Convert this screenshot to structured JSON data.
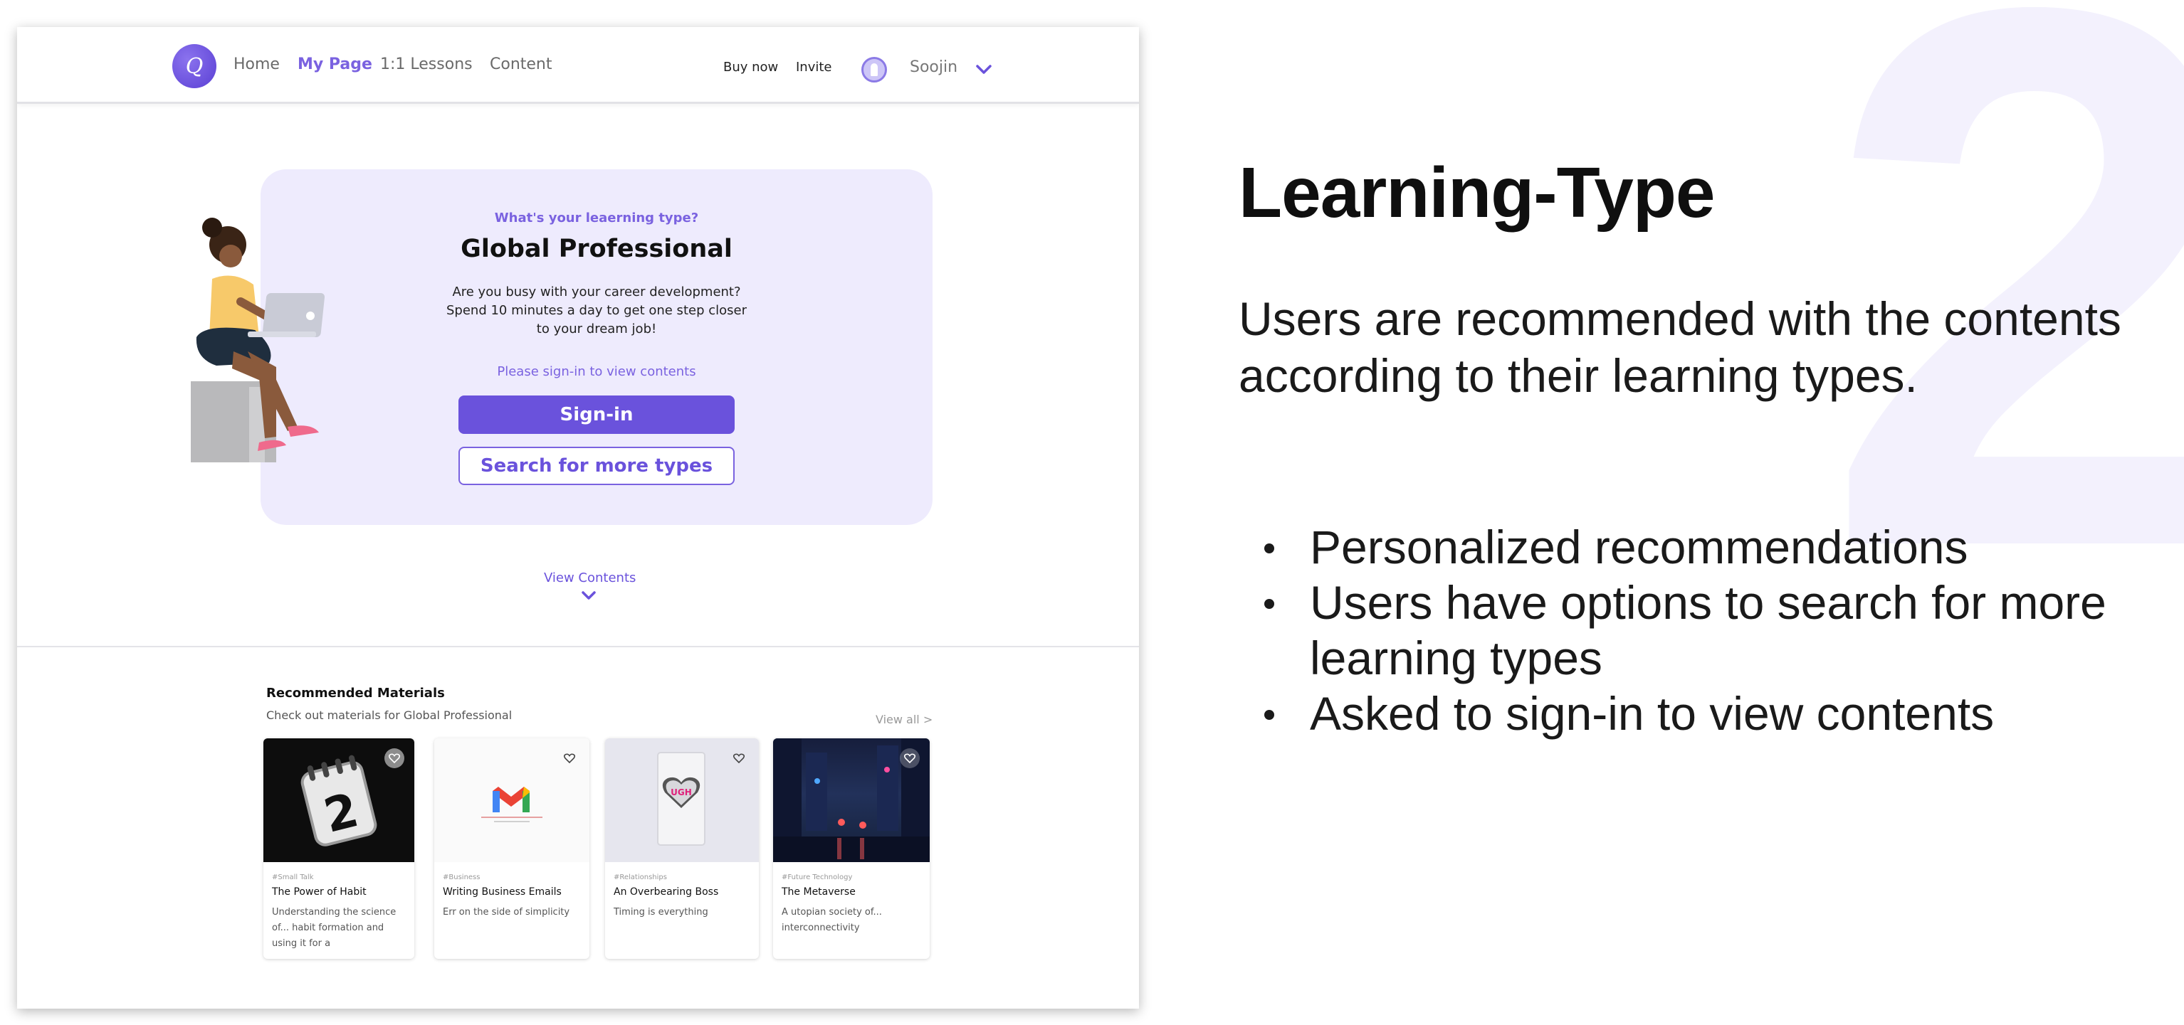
{
  "slide": {
    "number": "2",
    "title": "Learning-Type",
    "lead": "Users are recommended with the contents according to their learning types.",
    "bullets": [
      "Personalized recommendations",
      "Users have options to search for more learning types",
      "Asked to sign-in to view contents"
    ]
  },
  "nav": {
    "logo_text": "Q",
    "links": [
      "Home",
      "My Page",
      "1:1 Lessons",
      "Content"
    ],
    "active": "My Page",
    "buy_now": "Buy now",
    "invite": "Invite",
    "user_name": "Soojin",
    "user_menu_icon": "chevron-down-icon"
  },
  "hero": {
    "question": "What's your leaerning type?",
    "type_name": "Global Professional",
    "description_lines": [
      "Are you busy with your career development?",
      "Spend 10 minutes a day to get one step closer",
      "to your dream job!"
    ],
    "signin_note": "Please sign-in to view contents",
    "signin_button": "Sign-in",
    "search_button": "Search for more types",
    "view_contents": "View Contents"
  },
  "recommended": {
    "title": "Recommended Materials",
    "subtitle": "Check out materials for Global Professional",
    "view_all": "View all >",
    "cards": [
      {
        "tag": "#Small Talk",
        "title": "The Power of Habit",
        "desc": "Understanding the science of... habit formation and using it for a",
        "image": "calendar-2-image"
      },
      {
        "tag": "#Business",
        "title": "Writing Business Emails",
        "desc": "Err on the side of simplicity",
        "image": "gmail-logo-image"
      },
      {
        "tag": "#Relationships",
        "title": "An Overbearing Boss",
        "desc": "Timing is everything",
        "image": "ugh-heart-phone-image"
      },
      {
        "tag": "#Future Technology",
        "title": "The Metaverse",
        "desc": "A utopian society of... interconnectivity",
        "image": "night-city-street-image"
      }
    ]
  },
  "colors": {
    "accent": "#6a52dc",
    "accent_light": "#eeebfd",
    "background_number": "#f3f1fd"
  }
}
